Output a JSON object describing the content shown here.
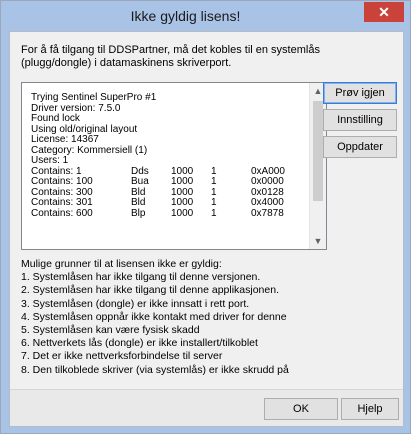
{
  "window": {
    "title": "Ikke gyldig lisens!",
    "close_label": "✕"
  },
  "intro_text": "For å få tilgang til DDSPartner, må det kobles til en systemlås (plugg/dongle) i datamaskinens skriverport.",
  "log": {
    "lines": [
      "Trying Sentinel SuperPro #1",
      "Driver version: 7.5.0",
      "Found lock",
      "Using old/original layout",
      "License: 14367",
      "Category: Kommersiell (1)",
      "Users: 1"
    ],
    "contains_rows": [
      [
        "Contains: 1",
        "Dds",
        "1000",
        "1",
        "0xA000"
      ],
      [
        "Contains: 100",
        "Bua",
        "1000",
        "1",
        "0x0000"
      ],
      [
        "Contains: 300",
        "Bld",
        "1000",
        "1",
        "0x0128"
      ],
      [
        "Contains: 301",
        "Bld",
        "1000",
        "1",
        "0x4000"
      ],
      [
        "Contains: 600",
        "Blp",
        "1000",
        "1",
        "0x7878"
      ]
    ]
  },
  "side_buttons": {
    "retry": "Prøv igjen",
    "settings": "Innstilling",
    "update": "Oppdater"
  },
  "reasons": {
    "heading": "Mulige grunner til at lisensen ikke er gyldig:",
    "items": [
      "1. Systemlåsen har ikke tilgang til denne versjonen.",
      "2. Systemlåsen har ikke tilgang til denne applikasjonen.",
      "3. Systemlåsen (dongle) er ikke innsatt i rett port.",
      "4. Systemlåsen oppnår ikke kontakt med driver for denne",
      "5. Systemlåsen kan være fysisk skadd",
      "6. Nettverkets lås (dongle) er ikke installert/tilkoblet",
      "7. Det er ikke nettverksforbindelse til server",
      "8. Den tilkoblede skriver (via systemlås) er ikke skrudd på"
    ]
  },
  "bottom_buttons": {
    "ok": "OK",
    "help": "Hjelp"
  }
}
